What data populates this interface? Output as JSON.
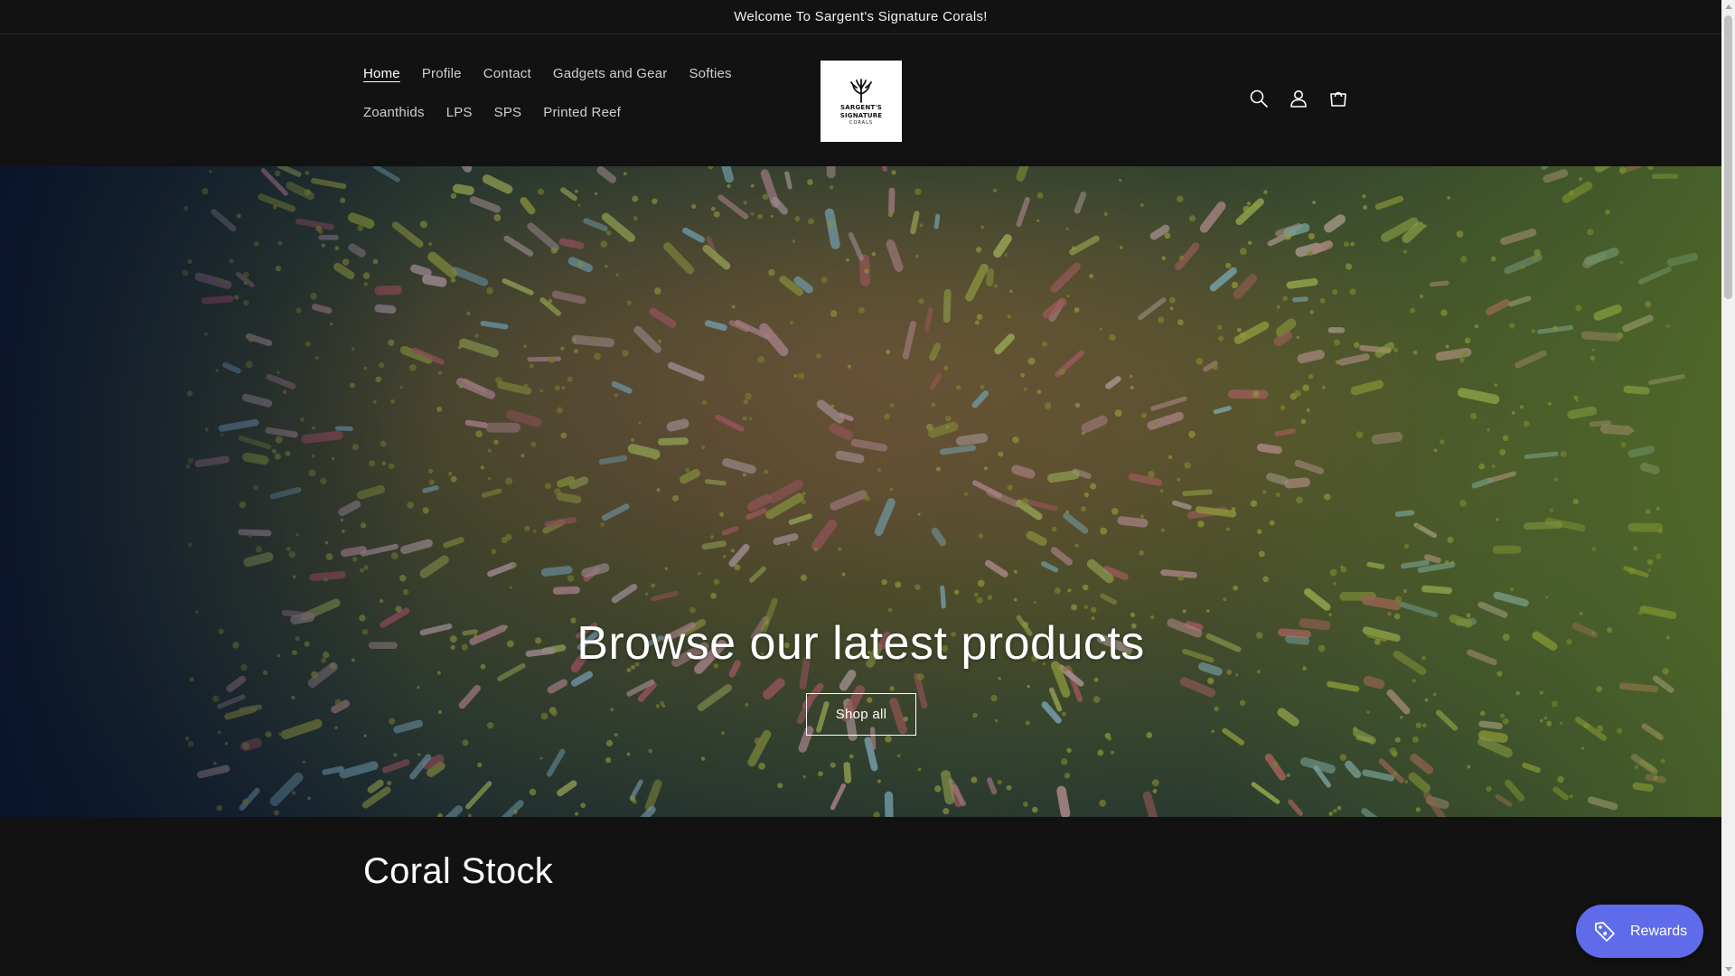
{
  "announcement": {
    "text": "Welcome To Sargent's Signature Corals!"
  },
  "header": {
    "nav_row1": [
      "Home",
      "Profile",
      "Contact",
      "Gadgets and Gear",
      "Softies"
    ],
    "nav_row2": [
      "Zoanthids",
      "LPS",
      "SPS",
      "Printed Reef"
    ],
    "active_item": "Home",
    "logo": {
      "line1": "SARGENT'S",
      "line2": "SIGNATURE",
      "line3": "CORALS"
    },
    "icons": [
      "search-icon",
      "account-icon",
      "cart-icon"
    ]
  },
  "hero": {
    "title": "Browse our latest products",
    "button_label": "Shop all"
  },
  "section": {
    "title": "Coral Stock"
  },
  "rewards": {
    "label": "Rewards",
    "icon": "tag-icon",
    "color": "#5f6be8"
  },
  "colors": {
    "background": "#121212",
    "text": "#ffffff"
  }
}
